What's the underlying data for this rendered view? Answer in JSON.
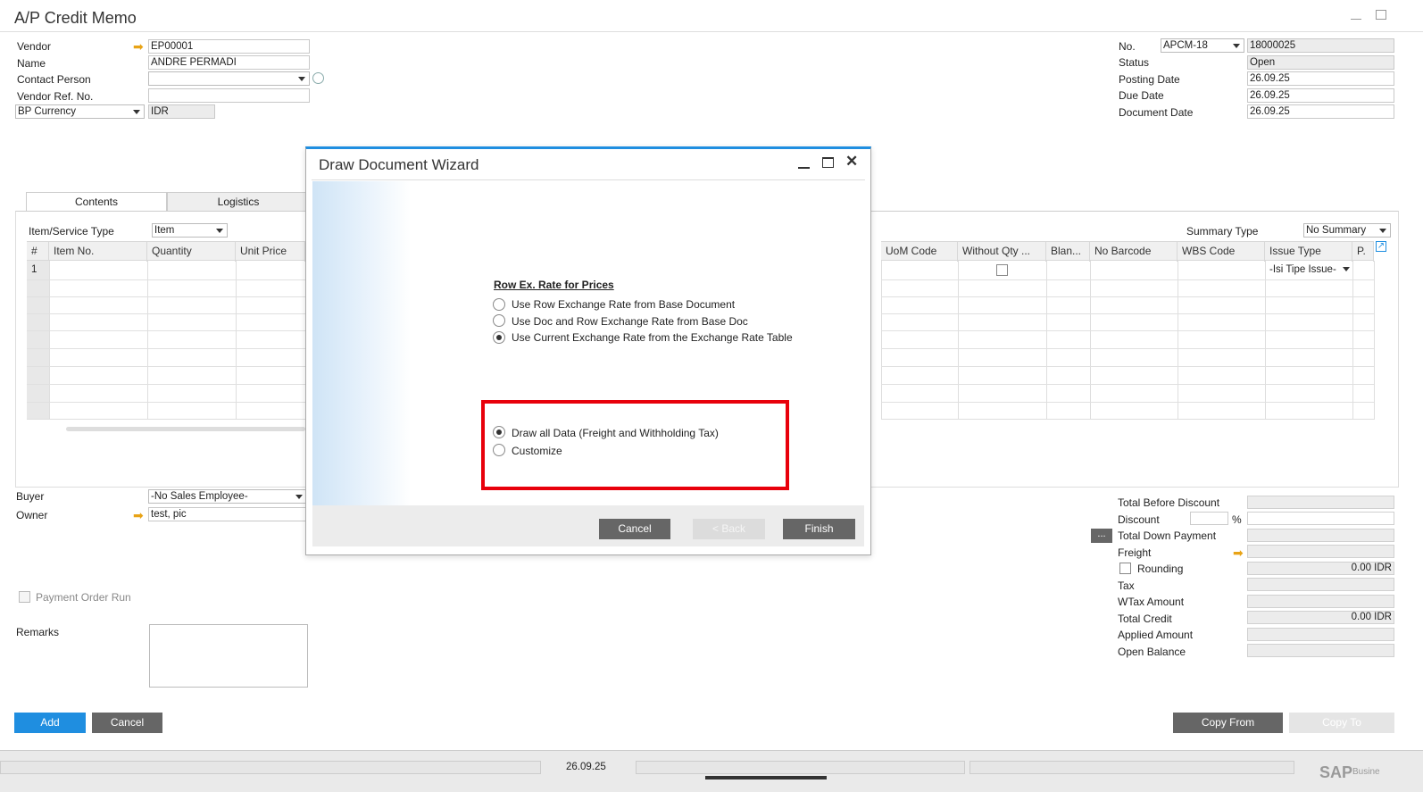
{
  "window": {
    "title": "A/P Credit Memo"
  },
  "header_left": {
    "vendor_label": "Vendor",
    "vendor_value": "EP00001",
    "name_label": "Name",
    "name_value": "ANDRE PERMADI",
    "contact_label": "Contact Person",
    "contact_value": "",
    "vendor_ref_label": "Vendor Ref. No.",
    "vendor_ref_value": "",
    "currency_select": "BP Currency",
    "currency_value": "IDR"
  },
  "header_right": {
    "no_label": "No.",
    "series_value": "APCM-18",
    "no_value": "18000025",
    "status_label": "Status",
    "status_value": "Open",
    "posting_label": "Posting Date",
    "posting_value": "26.09.25",
    "due_label": "Due Date",
    "due_value": "26.09.25",
    "docdate_label": "Document Date",
    "docdate_value": "26.09.25"
  },
  "tabs": [
    {
      "label": "Contents"
    },
    {
      "label": "Logistics"
    }
  ],
  "grid": {
    "type_label": "Item/Service Type",
    "type_value": "Item",
    "summary_label": "Summary Type",
    "summary_value": "No Summary",
    "columns_left": [
      "#",
      "Item No.",
      "Quantity",
      "Unit Price"
    ],
    "columns_right": [
      "UoM Code",
      "Without Qty ...",
      "Blan...",
      "No Barcode",
      "WBS Code",
      "Issue Type",
      "P."
    ],
    "row1_num": "1",
    "row1_issue_type": "-Isi Tipe Issue-"
  },
  "footer_left": {
    "buyer_label": "Buyer",
    "buyer_value": "-No Sales Employee-",
    "owner_label": "Owner",
    "owner_value": "test, pic",
    "payment_run_label": "Payment Order Run",
    "remarks_label": "Remarks"
  },
  "totals": {
    "before_discount": "Total Before Discount",
    "discount": "Discount",
    "percent": "%",
    "down_payment": "Total Down Payment",
    "freight": "Freight",
    "rounding": "Rounding",
    "rounding_value": "0.00 IDR",
    "tax": "Tax",
    "wtax": "WTax Amount",
    "total_credit": "Total Credit",
    "total_credit_value": "0.00 IDR",
    "applied": "Applied Amount",
    "open_balance": "Open Balance",
    "dots": "..."
  },
  "buttons": {
    "add": "Add",
    "cancel": "Cancel",
    "copy_from": "Copy From",
    "copy_to": "Copy To"
  },
  "statusbar": {
    "date": "26.09.25",
    "brand": "SAP",
    "brand_suffix": "Busine"
  },
  "dialog": {
    "title": "Draw Document Wizard",
    "section_title": "Row Ex. Rate for Prices",
    "options1": [
      {
        "label": "Use Row Exchange Rate from Base Document",
        "selected": false
      },
      {
        "label": "Use Doc and Row Exchange Rate from Base Doc",
        "selected": false
      },
      {
        "label": "Use Current Exchange Rate from the Exchange Rate Table",
        "selected": true
      }
    ],
    "options2": [
      {
        "label": "Draw all Data (Freight and Withholding Tax)",
        "selected": true
      },
      {
        "label": "Customize",
        "selected": false
      }
    ],
    "cancel": "Cancel",
    "back": "< Back",
    "finish": "Finish"
  },
  "colors": {
    "accent": "#1f8ee0",
    "button_dark": "#666666",
    "highlight": "#e8000b",
    "arrow": "#e8a316"
  }
}
